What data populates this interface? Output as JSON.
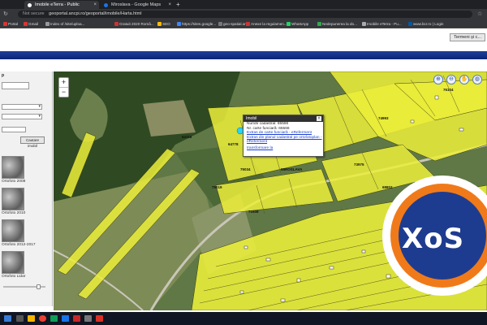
{
  "browser": {
    "tabs": [
      {
        "title": "Imobile eTerra - Public",
        "color": "#ffffff",
        "active": true
      },
      {
        "title": "Miroslava - Google Maps",
        "color": "#1a73e8",
        "active": false
      }
    ],
    "address": {
      "security": "Not secure",
      "url": "geoportal.ancpi.ro/geoportal/imobile/Harta.html"
    },
    "bookmarks": [
      {
        "label": "Portal",
        "color": "#d33"
      },
      {
        "label": "Gmail",
        "color": "#d33"
      },
      {
        "label": "Index of /site/uploa...",
        "color": "#999"
      },
      {
        "label": "Gratuit 2020 Româ...",
        "color": "#c33"
      },
      {
        "label": "SEO",
        "color": "#fbbc05"
      },
      {
        "label": "https://sites.google...",
        "color": "#4285f4"
      },
      {
        "label": "geo-spatial.org",
        "color": "#777"
      },
      {
        "label": "Anexe la regulamen...",
        "color": "#c33"
      },
      {
        "label": "WhatsApp",
        "color": "#25d366"
      },
      {
        "label": "Nedepunerea la do...",
        "color": "#34a853"
      },
      {
        "label": "Imobile eTerra - Pu...",
        "color": "#aaa"
      },
      {
        "label": "www.bcr.ro | Login",
        "color": "#0059a8"
      }
    ]
  },
  "app": {
    "header_button": "Termeni și c..."
  },
  "sidebar": {
    "search_button": "Cautare imobil",
    "thumbnails": [
      {
        "label": "Ortofoto 2008"
      },
      {
        "label": "Ortofoto 2010"
      },
      {
        "label": "Ortofoto 2012-2017"
      },
      {
        "label": "Ortofoto Lidar"
      }
    ],
    "opacity_level": 0.85
  },
  "map": {
    "zoom_in": "+",
    "zoom_out": "−",
    "tools": [
      "zoom-in-icon",
      "zoom-out-icon",
      "pan-hand-icon",
      "globe-icon"
    ],
    "parcel_color": "#ecef3a",
    "place_label": "MIROSLAVA",
    "parcel_ids": [
      "64116",
      "64778",
      "75034",
      "74993",
      "65566",
      "73975",
      "71508",
      "76104",
      "75019",
      "68803"
    ]
  },
  "popup": {
    "title": "Imobil",
    "close": "×",
    "cadastral_label": "Număr cadastral: 65566",
    "land_book_label": "Nr. carte funciară: 65566",
    "link_land_book": "Extras de carte funciară - eReferment",
    "link_plan": "Extras din planul cadastral pe ortofotoplan - eReferment",
    "link_transform": "transformare la"
  },
  "watermark": {
    "text": "XoS"
  }
}
